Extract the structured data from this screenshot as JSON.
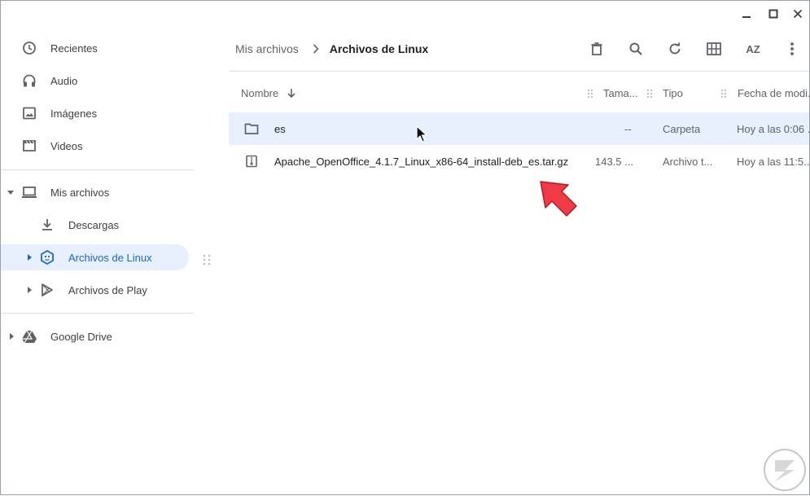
{
  "window": {
    "controls": [
      "minimize-icon",
      "maximize-icon",
      "close-icon"
    ]
  },
  "sidebar": {
    "items": [
      {
        "label": "Recientes",
        "icon": "clock-icon"
      },
      {
        "label": "Audio",
        "icon": "headphones-icon"
      },
      {
        "label": "Imágenes",
        "icon": "image-icon"
      },
      {
        "label": "Videos",
        "icon": "film-icon"
      },
      {
        "label": "Mis archivos",
        "icon": "laptop-icon"
      },
      {
        "label": "Descargas",
        "icon": "download-icon"
      },
      {
        "label": "Archivos de Linux",
        "icon": "linux-icon"
      },
      {
        "label": "Archivos de Play",
        "icon": "play-store-icon"
      },
      {
        "label": "Google Drive",
        "icon": "drive-icon"
      }
    ],
    "active_item": "Archivos de Linux"
  },
  "breadcrumb": {
    "parent": "Mis archivos",
    "current": "Archivos de Linux"
  },
  "toolbar": {
    "buttons": [
      "delete-icon",
      "search-icon",
      "refresh-icon",
      "grid-view-icon",
      "sort-icon",
      "more-icon"
    ],
    "sort_label": "AZ"
  },
  "table": {
    "headers": {
      "name": "Nombre",
      "size": "Tama...",
      "type": "Tipo",
      "date": "Fecha de modi..."
    },
    "rows": [
      {
        "name": "es",
        "size": "--",
        "type": "Carpeta",
        "date": "Hoy a las 0:06 ...",
        "icon": "folder-icon",
        "selected": true
      },
      {
        "name": "Apache_OpenOffice_4.1.7_Linux_x86-64_install-deb_es.tar.gz",
        "size": "143.5 ...",
        "type": "Archivo t...",
        "date": "Hoy a las 11:5...",
        "icon": "archive-icon",
        "selected": false
      }
    ]
  },
  "colors": {
    "accent": "#1967d2",
    "selected_bg": "#e8f0fe",
    "annotation_arrow": "#f03a47"
  }
}
